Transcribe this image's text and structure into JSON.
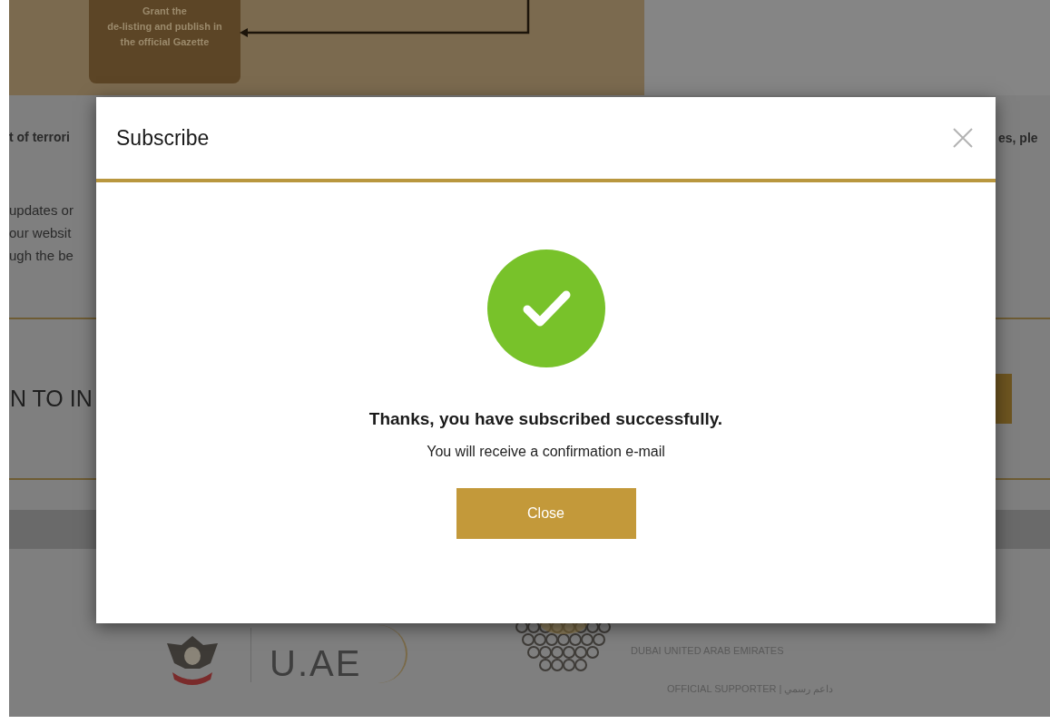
{
  "background": {
    "flow_step": {
      "lines": [
        "Grant the",
        "de-listing and publish in",
        "the official Gazette"
      ]
    },
    "left_heading": "t of terrori",
    "right_heading": "es, ple",
    "left_paragraph": [
      "updates or",
      "our websit",
      "ugh the be"
    ],
    "section_title": "N TO IN",
    "footer": {
      "uae_logo": "U.AE",
      "expo_caption": "DUBAI UNITED ARAB EMIRATES",
      "supporter": "OFFICIAL SUPPORTER | داعم رسمي"
    }
  },
  "modal": {
    "title": "Subscribe",
    "success": true,
    "message": "Thanks, you have subscribed successfully.",
    "note": "You will receive a confirmation e-mail",
    "button": "Close"
  }
}
